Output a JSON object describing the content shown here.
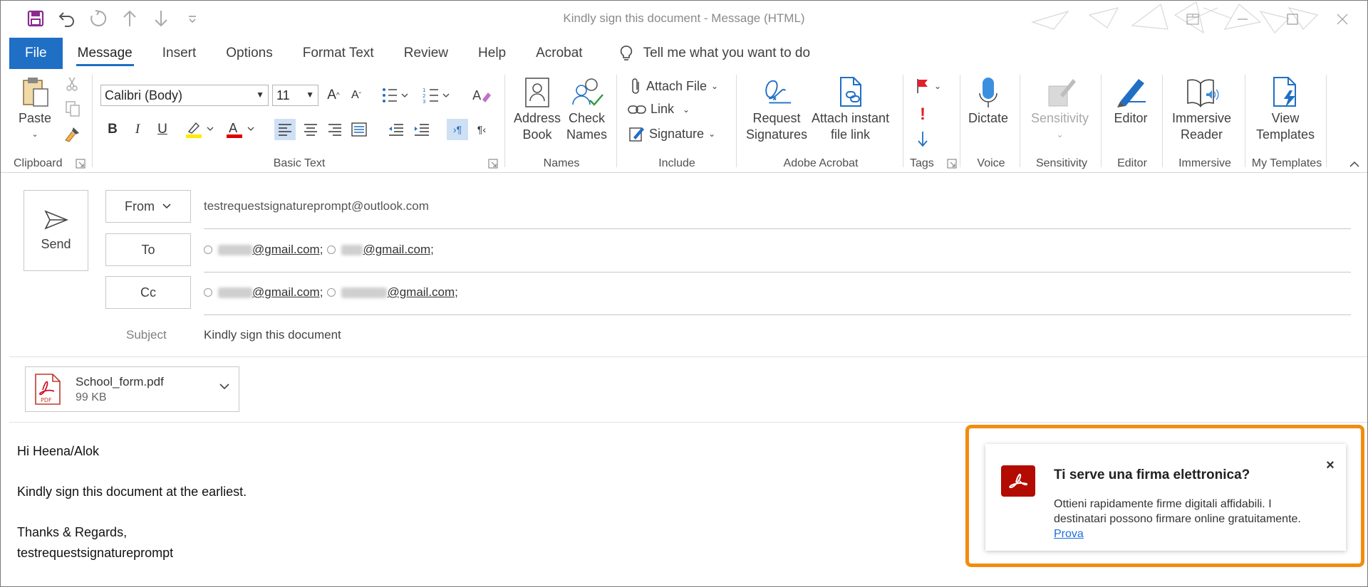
{
  "window": {
    "title": "Kindly sign this document  -  Message (HTML)"
  },
  "quick_access": [
    "save-icon",
    "undo-icon",
    "redo-icon",
    "up-arrow-icon",
    "down-arrow-icon",
    "customize-icon"
  ],
  "tabs": [
    {
      "label": "File"
    },
    {
      "label": "Message"
    },
    {
      "label": "Insert"
    },
    {
      "label": "Options"
    },
    {
      "label": "Format Text"
    },
    {
      "label": "Review"
    },
    {
      "label": "Help"
    },
    {
      "label": "Acrobat"
    }
  ],
  "tell_me": "Tell me what you want to do",
  "ribbon": {
    "clipboard": {
      "paste": "Paste",
      "label": "Clipboard"
    },
    "basic_text": {
      "font": "Calibri (Body)",
      "size": "11",
      "bold": "B",
      "italic": "I",
      "underline": "U",
      "label": "Basic Text"
    },
    "names": {
      "address_book_1": "Address",
      "address_book_2": "Book",
      "check_names_1": "Check",
      "check_names_2": "Names",
      "label": "Names"
    },
    "include": {
      "attach_file": "Attach File",
      "link": "Link",
      "signature": "Signature",
      "label": "Include"
    },
    "adobe": {
      "request_1": "Request",
      "request_2": "Signatures",
      "attach_1": "Attach instant",
      "attach_2": "file link",
      "label": "Adobe Acrobat"
    },
    "tags": {
      "label": "Tags"
    },
    "voice": {
      "dictate": "Dictate",
      "label": "Voice"
    },
    "sensitivity": {
      "button": "Sensitivity",
      "label": "Sensitivity"
    },
    "editor": {
      "button": "Editor",
      "label": "Editor"
    },
    "immersive": {
      "button_1": "Immersive",
      "button_2": "Reader",
      "label": "Immersive"
    },
    "templates": {
      "button_1": "View",
      "button_2": "Templates",
      "label": "My Templates"
    }
  },
  "compose": {
    "send": "Send",
    "from_label": "From",
    "from_value": "testrequestsignatureprompt@outlook.com",
    "to_label": "To",
    "to": [
      "@gmail.com;",
      "@gmail.com;"
    ],
    "cc_label": "Cc",
    "cc": [
      "@gmail.com;",
      "@gmail.com;"
    ],
    "subject_label": "Subject",
    "subject_value": "Kindly sign this document"
  },
  "attachment": {
    "name": "School_form.pdf",
    "size": "99 KB",
    "icon_text": "PDF"
  },
  "body": {
    "greeting": "Hi Heena/Alok",
    "line1": "Kindly sign this document at the earliest.",
    "line2": "Thanks & Regards,",
    "line3": "testrequestsignatureprompt"
  },
  "popup": {
    "title": "Ti serve una firma elettronica?",
    "text": "Ottieni rapidamente firme digitali affidabili. I destinatari possono firmare online gratuitamente.",
    "link": "Prova",
    "close": "×"
  },
  "colors": {
    "accent": "#1f6fc5",
    "adobe_red": "#b30b00",
    "highlight_frame": "#f28c0f"
  }
}
